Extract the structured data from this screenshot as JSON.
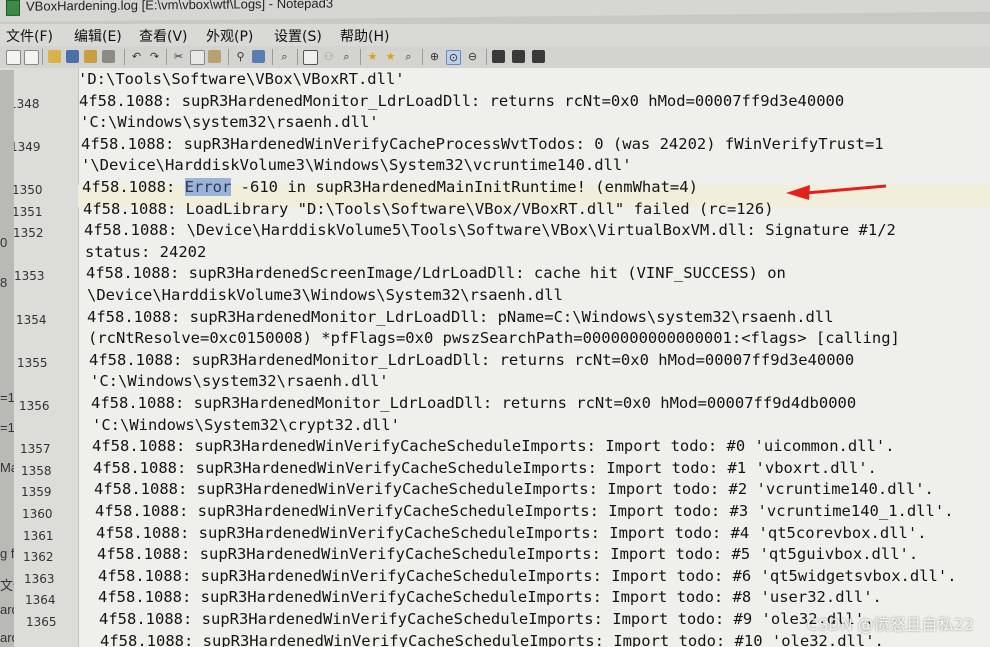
{
  "window": {
    "title": "VBoxHardening.log [E:\\vm\\vbox\\wtf\\Logs] - Notepad3"
  },
  "menu": [
    "文件(F)",
    "编辑(E)",
    "查看(V)",
    "外观(P)",
    "设置(S)",
    "帮助(H)"
  ],
  "toolbar_icons": [
    "new-file-icon",
    "open-file-icon",
    "open-folder-icon",
    "save-icon",
    "save-all-icon",
    "print-icon",
    "undo-icon",
    "redo-icon",
    "cut-icon",
    "copy-icon",
    "paste-icon",
    "find-icon",
    "replace-icon",
    "goto-icon",
    "view-icon",
    "bookmark-icon",
    "bookmark-next-icon",
    "zoom-in-icon",
    "zoom-reset-icon",
    "zoom-out-icon",
    "fullscreen-icon",
    "settings-icon",
    "exit-icon"
  ],
  "side_fragments": [
    "0",
    "8",
    "=1",
    "=1",
    "Ma",
    "g file",
    "文件写",
    "arder",
    "arder"
  ],
  "lines": [
    {
      "num": "",
      "text": "'D:\\Tools\\Software\\VBox\\VBoxRT.dll'"
    },
    {
      "num": "1348",
      "text": "4f58.1088: supR3HardenedMonitor_LdrLoadDll: returns rcNt=0x0 hMod=00007ff9d3e40000"
    },
    {
      "num": "",
      "text": "'C:\\Windows\\system32\\rsaenh.dll'"
    },
    {
      "num": "1349",
      "text": "4f58.1088: supR3HardenedWinVerifyCacheProcessWvtTodos: 0 (was 24202) fWinVerifyTrust=1"
    },
    {
      "num": "",
      "text": "'\\Device\\HarddiskVolume3\\Windows\\System32\\vcruntime140.dll'"
    },
    {
      "num": "1350",
      "pre": "4f58.1088: ",
      "err": "Error",
      "text": " -610 in supR3HardenedMainInitRuntime! (enmWhat=4)"
    },
    {
      "num": "1351",
      "text": "4f58.1088: LoadLibrary \"D:\\Tools\\Software\\VBox/VBoxRT.dll\" failed (rc=126)"
    },
    {
      "num": "1352",
      "text": "4f58.1088: \\Device\\HarddiskVolume5\\Tools\\Software\\VBox\\VirtualBoxVM.dll: Signature #1/2"
    },
    {
      "num": "",
      "text": "status: 24202"
    },
    {
      "num": "1353",
      "text": "4f58.1088: supR3HardenedScreenImage/LdrLoadDll: cache hit (VINF_SUCCESS) on"
    },
    {
      "num": "",
      "text": "\\Device\\HarddiskVolume3\\Windows\\System32\\rsaenh.dll"
    },
    {
      "num": "1354",
      "text": "4f58.1088: supR3HardenedMonitor_LdrLoadDll: pName=C:\\Windows\\system32\\rsaenh.dll"
    },
    {
      "num": "",
      "text": "(rcNtResolve=0xc0150008) *pfFlags=0x0 pwszSearchPath=0000000000000001:<flags> [calling]"
    },
    {
      "num": "1355",
      "text": "4f58.1088: supR3HardenedMonitor_LdrLoadDll: returns rcNt=0x0 hMod=00007ff9d3e40000"
    },
    {
      "num": "",
      "text": "'C:\\Windows\\system32\\rsaenh.dll'"
    },
    {
      "num": "1356",
      "text": "4f58.1088: supR3HardenedMonitor_LdrLoadDll: returns rcNt=0x0 hMod=00007ff9d4db0000"
    },
    {
      "num": "",
      "text": "'C:\\Windows\\System32\\crypt32.dll'"
    },
    {
      "num": "1357",
      "text": "4f58.1088: supR3HardenedWinVerifyCacheScheduleImports: Import todo: #0 'uicommon.dll'."
    },
    {
      "num": "1358",
      "text": "4f58.1088: supR3HardenedWinVerifyCacheScheduleImports: Import todo: #1 'vboxrt.dll'."
    },
    {
      "num": "1359",
      "text": "4f58.1088: supR3HardenedWinVerifyCacheScheduleImports: Import todo: #2 'vcruntime140.dll'."
    },
    {
      "num": "1360",
      "text": "4f58.1088: supR3HardenedWinVerifyCacheScheduleImports: Import todo: #3 'vcruntime140_1.dll'."
    },
    {
      "num": "1361",
      "text": "4f58.1088: supR3HardenedWinVerifyCacheScheduleImports: Import todo: #4 'qt5corevbox.dll'."
    },
    {
      "num": "1362",
      "text": "4f58.1088: supR3HardenedWinVerifyCacheScheduleImports: Import todo: #5 'qt5guivbox.dll'."
    },
    {
      "num": "1363",
      "text": "4f58.1088: supR3HardenedWinVerifyCacheScheduleImports: Import todo: #6 'qt5widgetsvbox.dll'."
    },
    {
      "num": "1364",
      "text": "4f58.1088: supR3HardenedWinVerifyCacheScheduleImports: Import todo: #8 'user32.dll'."
    },
    {
      "num": "1365",
      "text": "4f58.1088: supR3HardenedWinVerifyCacheScheduleImports: Import todo: #9 'ole32.dll'."
    },
    {
      "num": "",
      "text": "4f58.1088: supR3HardenedWinVerifyCacheScheduleImports: Import todo: #10 'ole32.dll'."
    }
  ],
  "colors": {
    "error_highlight": "#9bb3d6",
    "arrow": "#e3201b",
    "editor_bg": "#efefec"
  },
  "watermark": "CSDN @愤怒且自私22"
}
